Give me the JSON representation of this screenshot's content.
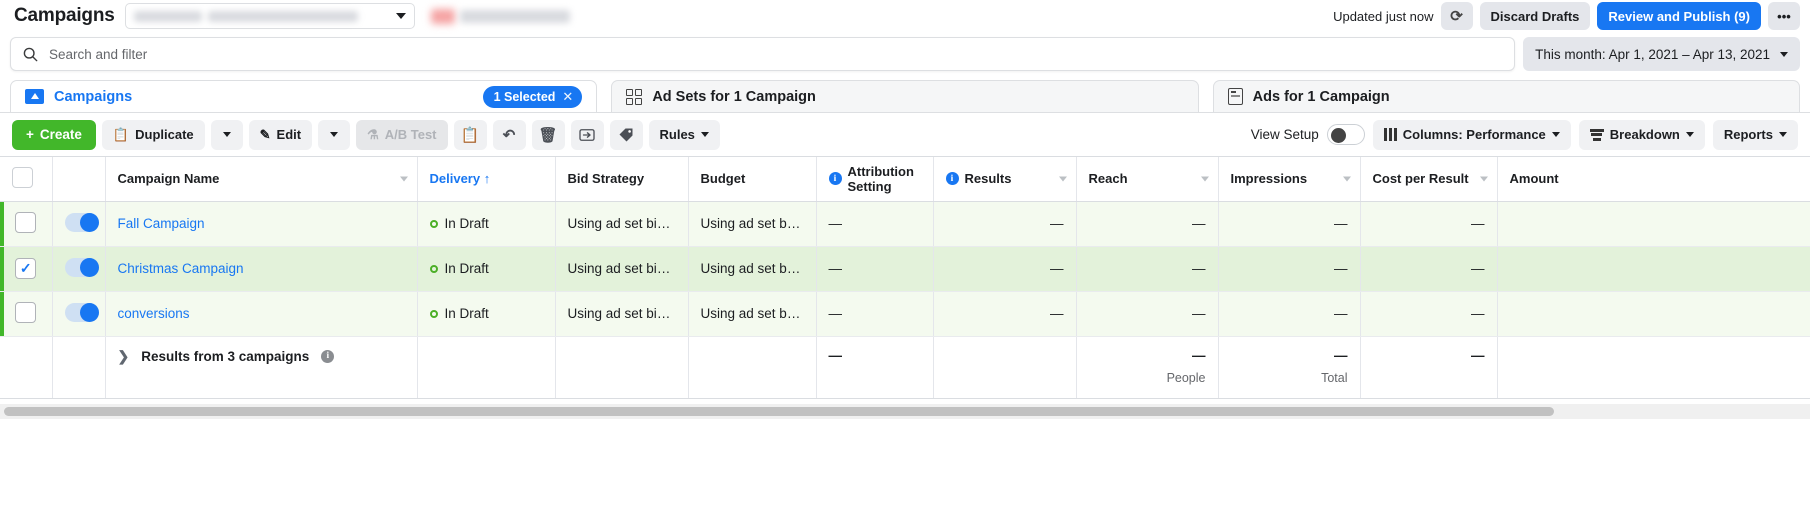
{
  "topbar": {
    "title": "Campaigns",
    "account_select_placeholder": "",
    "updated_text": "Updated just now",
    "refresh_icon": "refresh-icon",
    "discard_label": "Discard Drafts",
    "publish_label": "Review and Publish (9)",
    "more_label": "•••"
  },
  "search": {
    "placeholder": "Search and filter",
    "value": "",
    "icon": "search-icon",
    "date_range": "This month: Apr 1, 2021 – Apr 13, 2021"
  },
  "tabs": [
    {
      "label": "Campaigns",
      "icon": "folder-icon",
      "pill": "1 Selected",
      "pill_close": "✕",
      "active": true
    },
    {
      "label": "Ad Sets for 1 Campaign",
      "icon": "grid-icon",
      "active": false
    },
    {
      "label": "Ads for 1 Campaign",
      "icon": "card-icon",
      "active": false
    }
  ],
  "toolbar": {
    "create_label": "Create",
    "create_icon": "plus-icon",
    "duplicate_label": "Duplicate",
    "duplicate_icon": "copy-icon",
    "duplicate_caret": "caret-down-icon",
    "edit_label": "Edit",
    "edit_icon": "pencil-icon",
    "edit_caret": "caret-down-icon",
    "abtest_label": "A/B Test",
    "abtest_icon": "flask-icon",
    "paste_icon": "clipboard-icon",
    "undo_icon": "undo-arrow-icon",
    "delete_icon": "trash-icon",
    "export_icon": "export-icon",
    "tag_icon": "tag-icon",
    "rules_label": "Rules",
    "view_setup_label": "View Setup",
    "view_setup_on": false,
    "columns_label": "Columns: Performance",
    "columns_icon": "columns-icon",
    "breakdown_label": "Breakdown",
    "breakdown_icon": "breakdown-icon",
    "reports_label": "Reports"
  },
  "table": {
    "columns": [
      {
        "label": "Campaign Name",
        "sortable": true,
        "sorted": false,
        "info": false,
        "align": "left"
      },
      {
        "label": "Delivery ↑",
        "sortable": false,
        "sorted": true,
        "info": false,
        "align": "left"
      },
      {
        "label": "Bid Strategy",
        "sortable": false,
        "sorted": false,
        "info": false,
        "align": "left"
      },
      {
        "label": "Budget",
        "sortable": false,
        "sorted": false,
        "info": false,
        "align": "left"
      },
      {
        "label": "Attribution Setting",
        "sortable": false,
        "sorted": false,
        "info": true,
        "align": "left"
      },
      {
        "label": "Results",
        "sortable": true,
        "sorted": false,
        "info": true,
        "align": "left"
      },
      {
        "label": "Reach",
        "sortable": true,
        "sorted": false,
        "info": false,
        "align": "left"
      },
      {
        "label": "Impressions",
        "sortable": true,
        "sorted": false,
        "info": false,
        "align": "left"
      },
      {
        "label": "Cost per Result",
        "sortable": true,
        "sorted": false,
        "info": false,
        "align": "left"
      },
      {
        "label": "Amount",
        "sortable": false,
        "sorted": false,
        "info": false,
        "align": "left"
      }
    ],
    "rows": [
      {
        "selected": false,
        "toggle_on": true,
        "name": "Fall Campaign",
        "delivery": "In Draft",
        "bid_strategy": "Using ad set bid…",
        "budget": "Using ad set bu…",
        "attribution": "—",
        "results": "—",
        "reach": "—",
        "impressions": "—",
        "cost_per_result": "—",
        "amount": ""
      },
      {
        "selected": true,
        "toggle_on": true,
        "name": "Christmas Campaign",
        "delivery": "In Draft",
        "bid_strategy": "Using ad set bid…",
        "budget": "Using ad set bu…",
        "attribution": "—",
        "results": "—",
        "reach": "—",
        "impressions": "—",
        "cost_per_result": "—",
        "amount": ""
      },
      {
        "selected": false,
        "toggle_on": true,
        "name": "conversions",
        "delivery": "In Draft",
        "bid_strategy": "Using ad set bid…",
        "budget": "Using ad set bu…",
        "attribution": "—",
        "results": "—",
        "reach": "—",
        "impressions": "—",
        "cost_per_result": "—",
        "amount": ""
      }
    ],
    "summary": {
      "label": "Results from 3 campaigns",
      "expand_icon": "chevron-right-icon",
      "info_icon": "info-icon",
      "attribution": "—",
      "results": "",
      "reach": "—",
      "reach_note": "People",
      "impressions": "—",
      "impressions_note": "Total",
      "cost_per_result": "—",
      "amount": ""
    }
  }
}
